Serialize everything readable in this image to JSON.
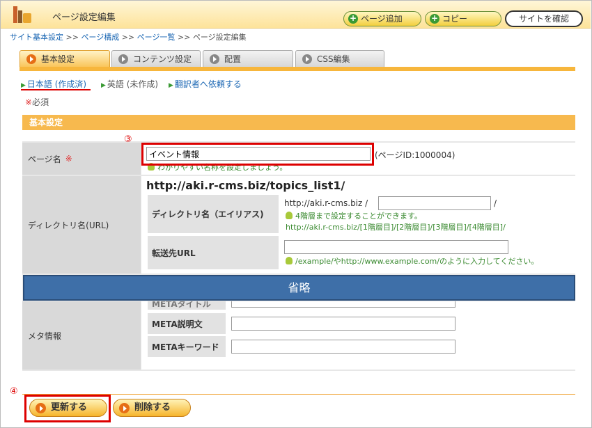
{
  "header": {
    "title": "ページ設定編集",
    "add_page_label": "ページ追加",
    "copy_label": "コピー",
    "confirm_site_label": "サイトを確認"
  },
  "breadcrumb": {
    "items": [
      "サイト基本設定",
      "ページ構成",
      "ページ一覧"
    ],
    "separator": ">>",
    "current": "ページ設定編集"
  },
  "tabs": [
    "基本設定",
    "コンテンツ設定",
    "配置",
    "CSS編集"
  ],
  "languages": {
    "jp": "日本語 (作成済)",
    "en": "英語 (未作成)",
    "translate": "翻訳者へ依頼する"
  },
  "required_note": {
    "mark": "※",
    "text": "必須"
  },
  "section_title": "基本設定",
  "annotations": {
    "step3": "③",
    "step4": "④"
  },
  "page_name": {
    "label": "ページ名",
    "required_mark": "※",
    "value": "イベント情報",
    "page_id": "(ページID:1000004)",
    "hint": "わかりやすい名称を設定しましょう。"
  },
  "directory": {
    "label": "ディレクトリ名(URL)",
    "url": "http://aki.r-cms.biz/topics_list1/",
    "alias_label": "ディレクトリ名（エイリアス)",
    "alias_prefix": "http://aki.r-cms.biz /",
    "alias_suffix": "/",
    "alias_hint": "4階層まで設定することができます。",
    "alias_example": "http://aki.r-cms.biz/[1階層目]/[2階層目]/[3階層目]/[4階層目]/",
    "redirect_label": "転送先URL",
    "redirect_hint": "/example/やhttp://www.example.com/のように入力してください。"
  },
  "omitted_label": "省略",
  "meta": {
    "label": "メタ情報",
    "title_label": "METAタイトル",
    "desc_label": "META説明文",
    "keywords_label": "METAキーワード"
  },
  "actions": {
    "update_label": "更新する",
    "delete_label": "削除する"
  },
  "colors": {
    "accent_orange": "#f7b63c",
    "annotation_red": "#dd0000",
    "omit_blue": "#3e6fa8",
    "hint_green": "#3a8a30"
  }
}
